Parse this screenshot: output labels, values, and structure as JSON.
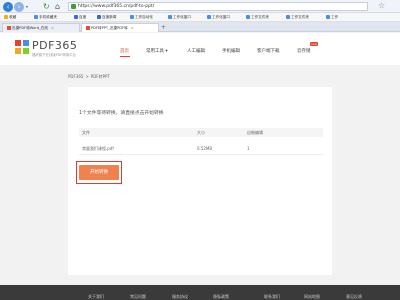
{
  "browser": {
    "url": "https://www.pdf365.cn/pdf-to-ppt/",
    "bookmarks": [
      {
        "label": "收藏",
        "color": "#f5a623"
      },
      {
        "label": "手机收藏夹",
        "color": "#4a90e2"
      },
      {
        "label": "百度",
        "color": "#3b66d8"
      },
      {
        "label": "百度新闻",
        "color": "#3b66d8"
      },
      {
        "label": "工作自动化",
        "color": "#4a90e2"
      },
      {
        "label": "工作化窗口",
        "color": "#4a90e2"
      },
      {
        "label": "工作化窗口",
        "color": "#4a90e2"
      },
      {
        "label": "工作文件夹",
        "color": "#4a90e2"
      },
      {
        "label": "工作文件夹",
        "color": "#4a90e2"
      },
      {
        "label": "工作",
        "color": "#4a90e2"
      }
    ],
    "tabs": [
      {
        "label": "迅捷PDF转Word_在线"
      },
      {
        "label": "PDF转PPT_迅捷PDF转"
      }
    ]
  },
  "site": {
    "logo_text": "PDF365",
    "logo_subtitle": "福昕旗下在线版PDF转换平台",
    "menu": [
      {
        "label": "首页"
      },
      {
        "label": "常用工具 ▾"
      },
      {
        "label": "人工编辑"
      },
      {
        "label": "手机编辑"
      },
      {
        "label": "客户端下载"
      },
      {
        "label": "云存储"
      }
    ],
    "badge": "new"
  },
  "breadcrumb": {
    "home": "PDF365",
    "sep": ">",
    "current": "PDF转PPT"
  },
  "card": {
    "title": "1个文件等待转换，请直接点击开始转换",
    "columns": [
      "文件",
      "大小",
      "自制编辑"
    ],
    "files": [
      {
        "name": "常量我们课程.pdf",
        "size": "0.52MB",
        "pages": "1"
      }
    ],
    "start_button": "开始转换"
  },
  "footer": {
    "items": [
      "关于我们",
      "常见问题",
      "服务协议",
      "隐私政策",
      "联系我们",
      "网站地图",
      "意见反馈"
    ]
  },
  "colors": {
    "accent": "#e9412b",
    "button": "#f0824f",
    "highlight": "#e53b2c"
  }
}
